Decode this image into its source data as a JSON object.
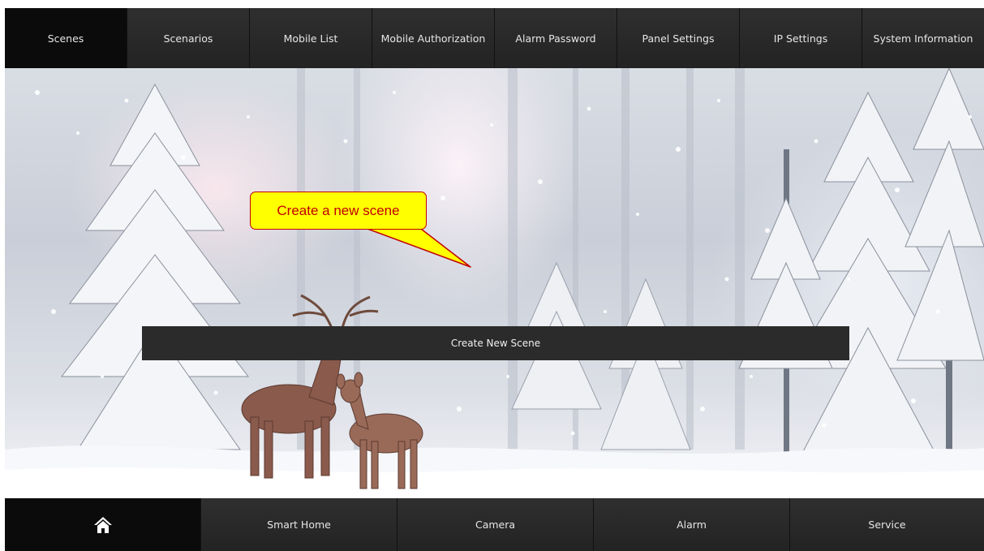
{
  "top_tabs": [
    {
      "label": "Scenes"
    },
    {
      "label": "Scenarios"
    },
    {
      "label": "Mobile List"
    },
    {
      "label": "Mobile Authorization"
    },
    {
      "label": "Alarm Password"
    },
    {
      "label": "Panel Settings"
    },
    {
      "label": "IP Settings"
    },
    {
      "label": "System Information"
    }
  ],
  "active_tab": "Scenes",
  "main": {
    "create_button_label": "Create New Scene",
    "background": "winter-forest-deer-image"
  },
  "callout": {
    "text": "Create a new scene",
    "fill": "#ffff00",
    "text_color": "#c00000"
  },
  "bottom_nav": {
    "home_icon": "home-icon",
    "items": [
      {
        "label": "Smart Home"
      },
      {
        "label": "Camera"
      },
      {
        "label": "Alarm"
      },
      {
        "label": "Service"
      }
    ]
  }
}
